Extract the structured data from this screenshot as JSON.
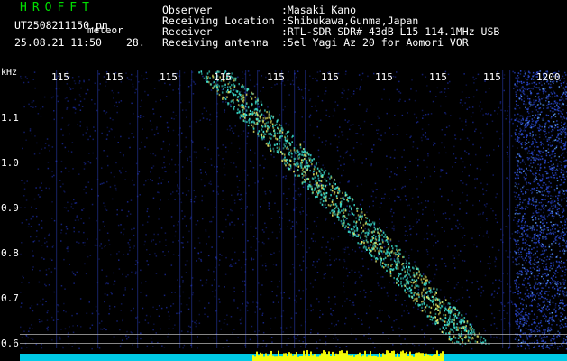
{
  "header": {
    "app_title": "HROFFT",
    "file_name": "UT2508211150.pn",
    "file_tag": "meteor",
    "timestamp": "25.08.21 11:50",
    "level": "28."
  },
  "info": [
    {
      "label": "Observer",
      "value": ":Masaki Kano"
    },
    {
      "label": "Receiving Location",
      "value": ":Shibukawa,Gunma,Japan"
    },
    {
      "label": "Receiver",
      "value": ":RTL-SDR SDR# 43dB L15 114.1MHz USB"
    },
    {
      "label": "Receiving antenna",
      "value": ":5el Yagi Az 20 for Aomori VOR"
    }
  ],
  "axes": {
    "y_unit": "kHz",
    "top_ticks": [
      "115",
      "115",
      "115",
      "115",
      "115",
      "115",
      "115",
      "115",
      "115",
      "1200"
    ],
    "left_ticks": [
      "1.1",
      "1.0",
      "0.9",
      "0.8",
      "0.7",
      "0.6"
    ]
  },
  "colors": {
    "background": "#000000",
    "title": "#00e000",
    "text": "#ffffff",
    "noise": "#1a2a9a",
    "trail": "#33d0c0",
    "baseline_yellow": "#ffff00",
    "baseline_cyan": "#00e0ff"
  }
}
